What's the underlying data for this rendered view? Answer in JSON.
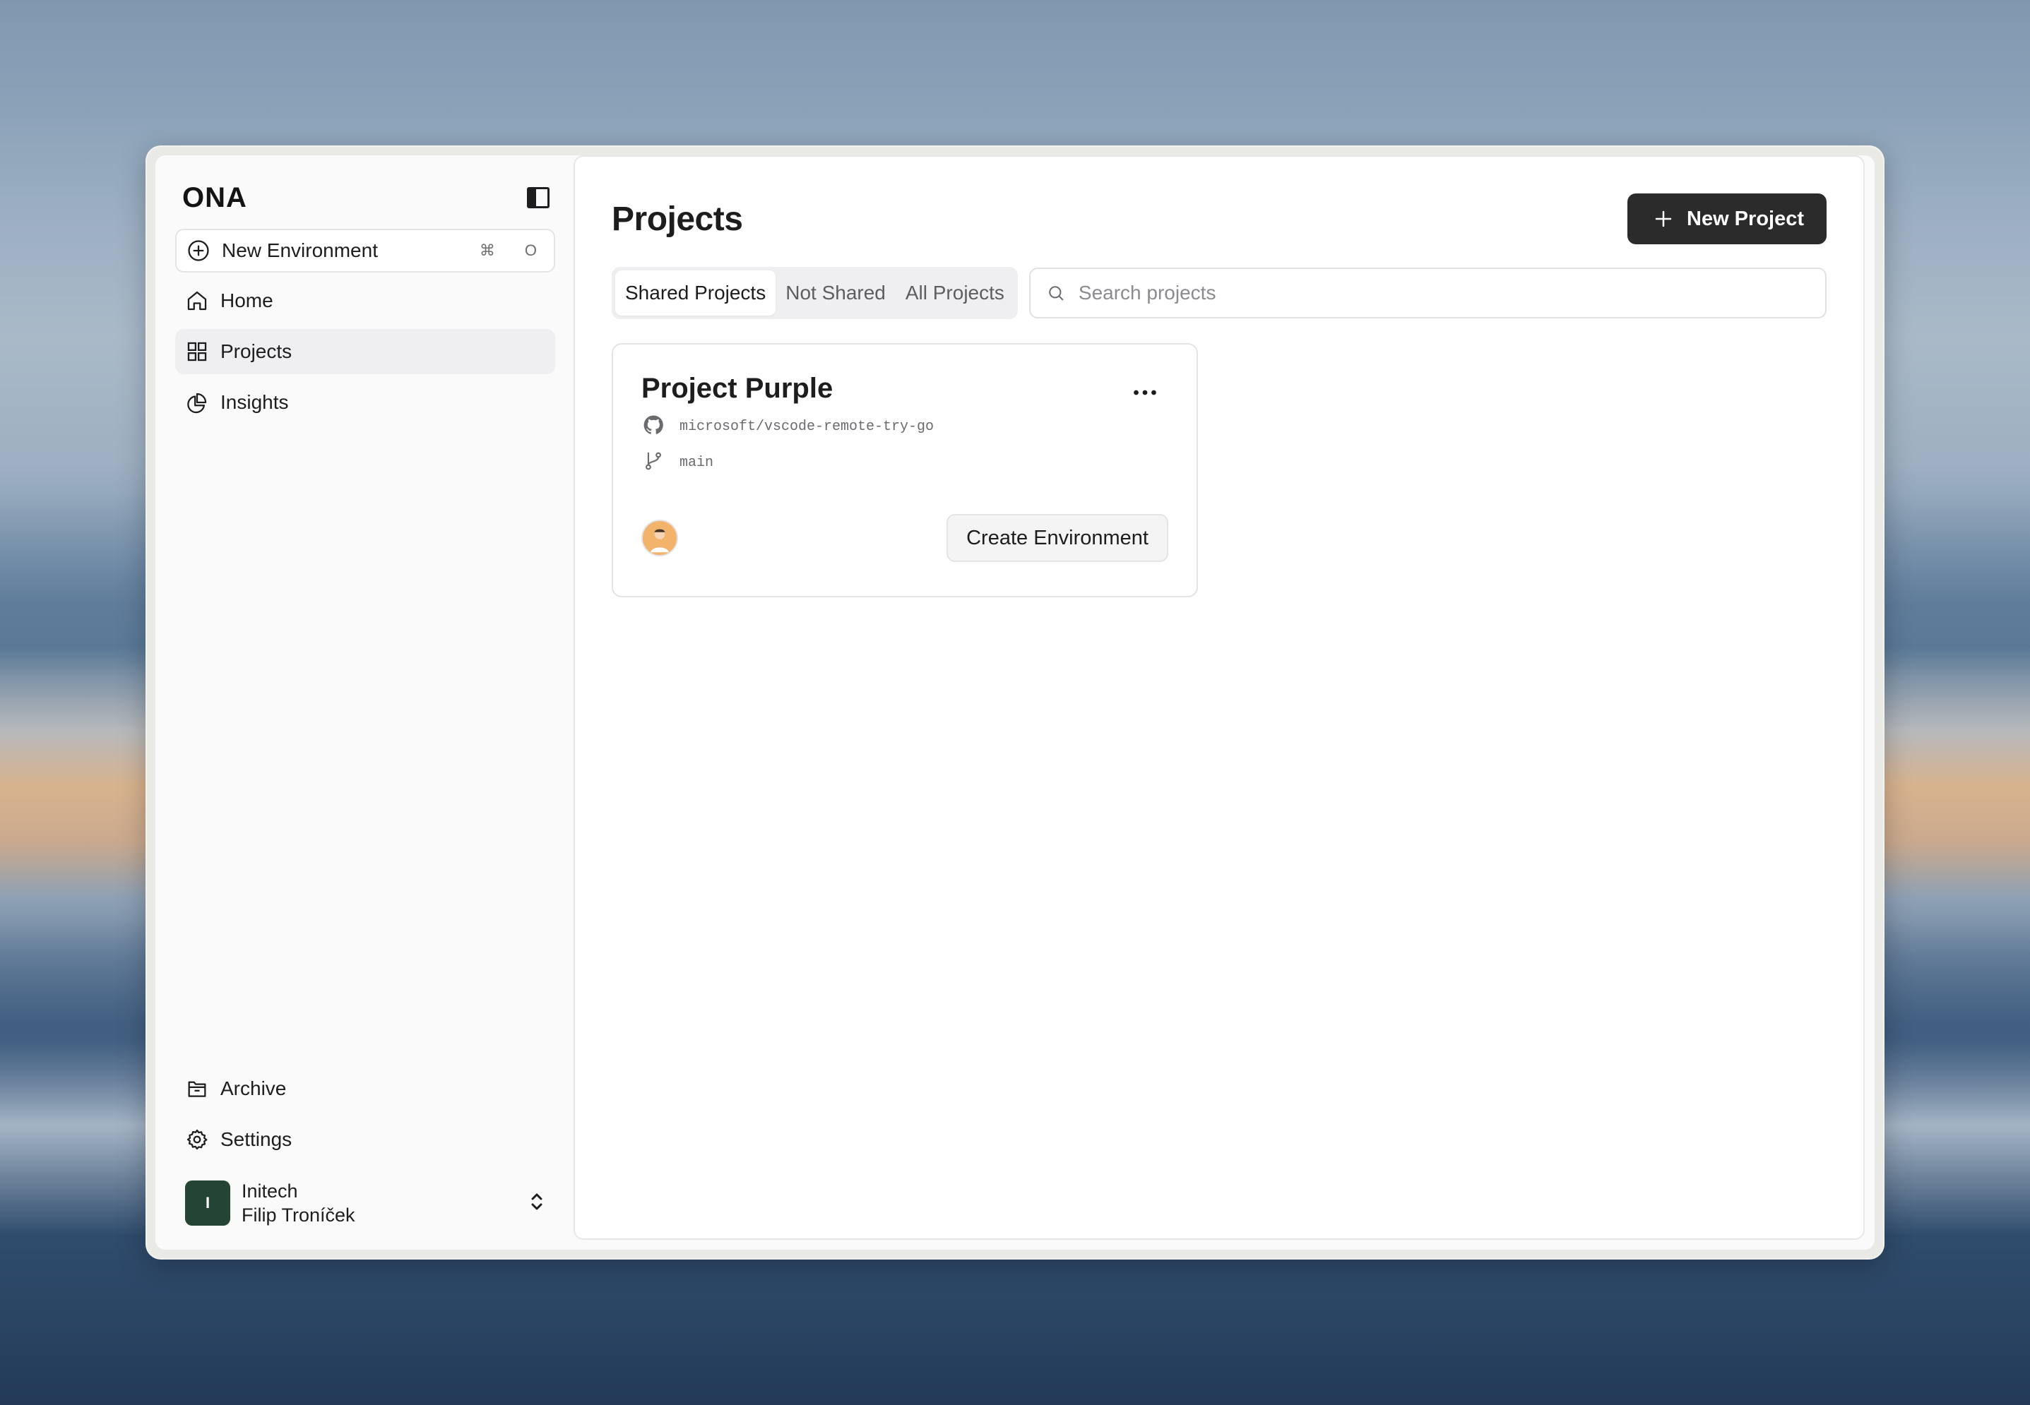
{
  "app": {
    "logo": "ONA"
  },
  "sidebar": {
    "new_environment": {
      "label": "New Environment",
      "shortcut_symbol": "⌘",
      "shortcut_key": "O"
    },
    "items": [
      {
        "label": "Home",
        "icon": "home-icon",
        "active": false
      },
      {
        "label": "Projects",
        "icon": "grid-icon",
        "active": true
      },
      {
        "label": "Insights",
        "icon": "pie-chart-icon",
        "active": false
      }
    ],
    "bottom_items": [
      {
        "label": "Archive",
        "icon": "archive-icon"
      },
      {
        "label": "Settings",
        "icon": "gear-icon"
      }
    ],
    "user": {
      "avatar_letter": "I",
      "org": "Initech",
      "name": "Filip Troníček"
    }
  },
  "main": {
    "title": "Projects",
    "new_project_label": "New Project",
    "tabs": [
      {
        "label": "Shared Projects",
        "active": true
      },
      {
        "label": "Not Shared",
        "active": false
      },
      {
        "label": "All Projects",
        "active": false
      }
    ],
    "search": {
      "placeholder": "Search projects",
      "value": ""
    },
    "projects": [
      {
        "name": "Project Purple",
        "repo": "microsoft/vscode-remote-try-go",
        "branch": "main",
        "action_label": "Create Environment"
      }
    ]
  },
  "colors": {
    "primary_button": "#2b2b2b",
    "user_avatar_bg": "#254534",
    "active_nav_bg": "#efeef0"
  }
}
